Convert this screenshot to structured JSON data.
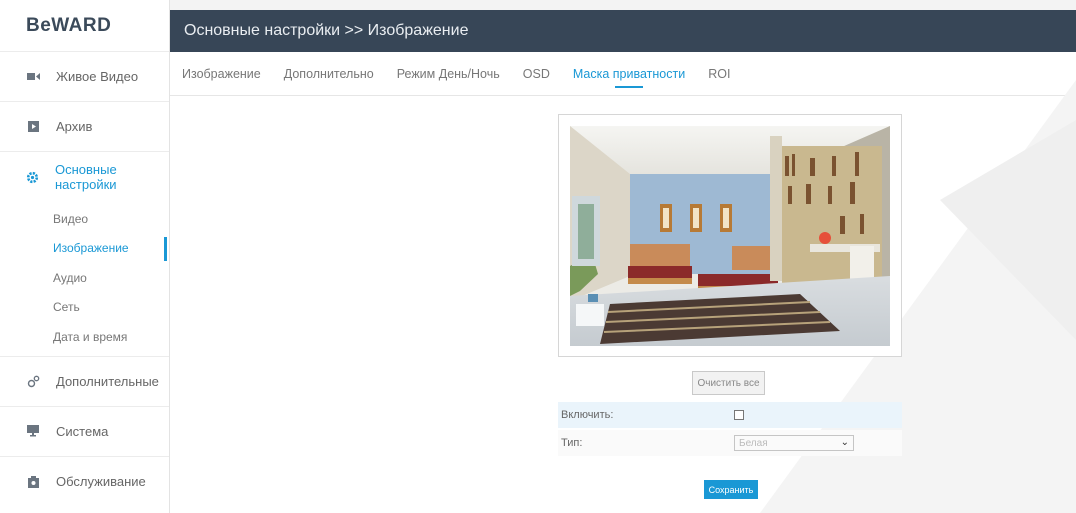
{
  "brand": {
    "logo_text": "BeWARD"
  },
  "sidebar": {
    "items": [
      {
        "label": "Живое Видео",
        "icon": "video-camera-icon"
      },
      {
        "label": "Архив",
        "icon": "archive-icon"
      },
      {
        "label": "Основные настройки",
        "icon": "gear-icon",
        "active": true
      },
      {
        "label": "Дополнительные",
        "icon": "gears-icon"
      },
      {
        "label": "Система",
        "icon": "monitor-icon"
      },
      {
        "label": "Обслуживание",
        "icon": "maintenance-icon"
      }
    ],
    "subitems": [
      {
        "label": "Видео"
      },
      {
        "label": "Изображение",
        "active": true
      },
      {
        "label": "Аудио"
      },
      {
        "label": "Сеть"
      },
      {
        "label": "Дата и время"
      }
    ]
  },
  "header": {
    "title": "Основные настройки >> Изображение"
  },
  "tabs": [
    {
      "label": "Изображение"
    },
    {
      "label": "Дополнительно"
    },
    {
      "label": "Режим День/Ночь"
    },
    {
      "label": "OSD"
    },
    {
      "label": "Маска приватности",
      "active": true
    },
    {
      "label": "ROI"
    }
  ],
  "mask": {
    "clear_label": "Очистить все",
    "enable_label": "Включить:",
    "enable_checked": false,
    "type_label": "Тип:",
    "type_value": "Белая",
    "save_label": "Сохранить"
  },
  "colors": {
    "accent": "#1a98d5",
    "header_bg": "#374657"
  }
}
